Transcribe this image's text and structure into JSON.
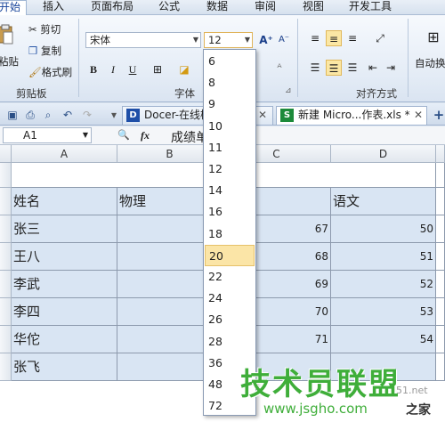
{
  "menu": {
    "tabs": [
      "开始",
      "插入",
      "页面布局",
      "公式",
      "数据",
      "审阅",
      "视图",
      "开发工具"
    ],
    "active": 0
  },
  "clipboard": {
    "paste_label": "粘贴",
    "cut_label": "剪切",
    "copy_label": "复制",
    "format_painter_label": "格式刷",
    "group_label": "剪贴板"
  },
  "font": {
    "family": "宋体",
    "size": "12",
    "bold": "B",
    "italic": "I",
    "underline": "U",
    "grow": "A⁺",
    "shrink": "A⁻",
    "group_label": "字体"
  },
  "alignment": {
    "wrap_label": "自动换",
    "group_label": "对齐方式"
  },
  "doc_tabs": [
    {
      "label": "Docer-在线模",
      "icon": "D",
      "active": false
    },
    {
      "label": "新建 Micro...作表.xls *",
      "icon": "S",
      "active": true
    }
  ],
  "formula_bar": {
    "cell_ref": "A1",
    "fx_label": "fx",
    "content": "成绩单"
  },
  "columns": [
    "A",
    "B",
    "C",
    "D"
  ],
  "rows": [
    {
      "a": "",
      "b": "",
      "c": "",
      "d": ""
    },
    {
      "a": "姓名",
      "b": "物理",
      "c": "",
      "d": "语文"
    },
    {
      "a": "张三",
      "b": "",
      "c": "67",
      "d": "50"
    },
    {
      "a": "王八",
      "b": "",
      "c": "68",
      "d": "51"
    },
    {
      "a": "李武",
      "b": "",
      "c": "69",
      "d": "52"
    },
    {
      "a": "李四",
      "b": "",
      "c": "70",
      "d": "53"
    },
    {
      "a": "华佗",
      "b": "",
      "c": "71",
      "d": "54"
    },
    {
      "a": "张飞",
      "b": "",
      "c": "",
      "d": ""
    }
  ],
  "font_size_dropdown": {
    "options": [
      "6",
      "8",
      "9",
      "10",
      "11",
      "12",
      "14",
      "16",
      "18",
      "20",
      "22",
      "24",
      "26",
      "28",
      "36",
      "48",
      "72"
    ],
    "highlighted": "20"
  },
  "watermark": {
    "main": "技术员联盟",
    "url": "www.jsgho.com",
    "small": "51.net",
    "corner": "之家"
  }
}
